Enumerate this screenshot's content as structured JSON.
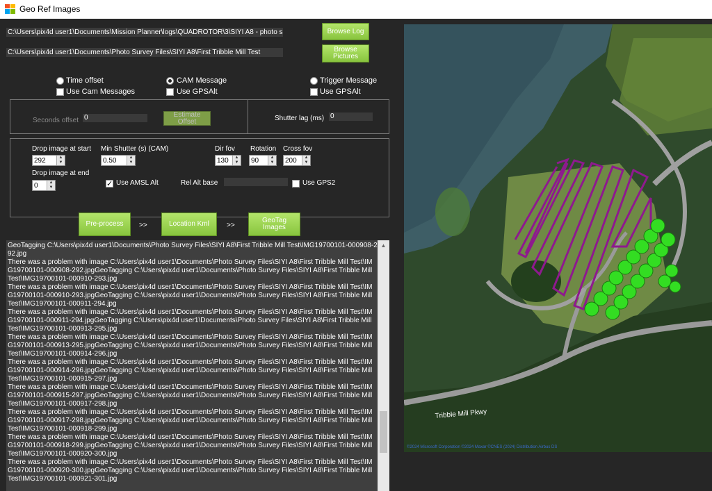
{
  "window": {
    "title": "Geo Ref Images"
  },
  "log_path": "C:\\Users\\pix4d user1\\Documents\\Mission Planner\\logs\\QUADROTOR\\3\\SIYI A8 - photo s",
  "pictures_path": "C:\\Users\\pix4d user1\\Documents\\Photo Survey Files\\SIYI A8\\First Tribble Mill Test",
  "buttons": {
    "browse_log": "Browse Log",
    "browse_pictures": "Browse Pictures",
    "estimate_offset": "Estimate Offset",
    "preprocess": "Pre-process",
    "location_kml": "Location Kml",
    "geotag_images": "GeoTag Images",
    "arrow": ">>"
  },
  "modes": {
    "time_offset": "Time offset",
    "cam_message": "CAM Message",
    "trigger_message": "Trigger Message",
    "use_cam_messages": "Use Cam Messages",
    "use_gpsalt_1": "Use GPSAlt",
    "use_gpsalt_2": "Use GPSAlt",
    "selected": "CAM Message"
  },
  "offset": {
    "seconds_label": "Seconds offset",
    "seconds_value": "0",
    "shutter_lag_label": "Shutter lag (ms)",
    "shutter_lag_value": "0"
  },
  "params": {
    "drop_start_label": "Drop image at start",
    "drop_start": "292",
    "drop_end_label": "Drop image at end",
    "drop_end": "0",
    "min_shutter_label": "Min Shutter (s) (CAM)",
    "min_shutter": "0.50",
    "use_amsl_label": "Use AMSL Alt",
    "dir_fov_label": "Dir fov",
    "dir_fov": "130",
    "rotation_label": "Rotation",
    "rotation": "90",
    "cross_fov_label": "Cross fov",
    "cross_fov": "200",
    "rel_alt_label": "Rel Alt base",
    "rel_alt": "",
    "use_gps2_label": "Use GPS2"
  },
  "log_text": "GeoTagging C:\\Users\\pix4d user1\\Documents\\Photo Survey Files\\SIYI A8\\First Tribble Mill Test\\IMG19700101-000908-292.jpg\nThere was a problem with image C:\\Users\\pix4d user1\\Documents\\Photo Survey Files\\SIYI A8\\First Tribble Mill Test\\IMG19700101-000908-292.jpgGeoTagging C:\\Users\\pix4d user1\\Documents\\Photo Survey Files\\SIYI A8\\First Tribble Mill Test\\IMG19700101-000910-293.jpg\nThere was a problem with image C:\\Users\\pix4d user1\\Documents\\Photo Survey Files\\SIYI A8\\First Tribble Mill Test\\IMG19700101-000910-293.jpgGeoTagging C:\\Users\\pix4d user1\\Documents\\Photo Survey Files\\SIYI A8\\First Tribble Mill Test\\IMG19700101-000911-294.jpg\nThere was a problem with image C:\\Users\\pix4d user1\\Documents\\Photo Survey Files\\SIYI A8\\First Tribble Mill Test\\IMG19700101-000911-294.jpgGeoTagging C:\\Users\\pix4d user1\\Documents\\Photo Survey Files\\SIYI A8\\First Tribble Mill Test\\IMG19700101-000913-295.jpg\nThere was a problem with image C:\\Users\\pix4d user1\\Documents\\Photo Survey Files\\SIYI A8\\First Tribble Mill Test\\IMG19700101-000913-295.jpgGeoTagging C:\\Users\\pix4d user1\\Documents\\Photo Survey Files\\SIYI A8\\First Tribble Mill Test\\IMG19700101-000914-296.jpg\nThere was a problem with image C:\\Users\\pix4d user1\\Documents\\Photo Survey Files\\SIYI A8\\First Tribble Mill Test\\IMG19700101-000914-296.jpgGeoTagging C:\\Users\\pix4d user1\\Documents\\Photo Survey Files\\SIYI A8\\First Tribble Mill Test\\IMG19700101-000915-297.jpg\nThere was a problem with image C:\\Users\\pix4d user1\\Documents\\Photo Survey Files\\SIYI A8\\First Tribble Mill Test\\IMG19700101-000915-297.jpgGeoTagging C:\\Users\\pix4d user1\\Documents\\Photo Survey Files\\SIYI A8\\First Tribble Mill Test\\IMG19700101-000917-298.jpg\nThere was a problem with image C:\\Users\\pix4d user1\\Documents\\Photo Survey Files\\SIYI A8\\First Tribble Mill Test\\IMG19700101-000917-298.jpgGeoTagging C:\\Users\\pix4d user1\\Documents\\Photo Survey Files\\SIYI A8\\First Tribble Mill Test\\IMG19700101-000918-299.jpg\nThere was a problem with image C:\\Users\\pix4d user1\\Documents\\Photo Survey Files\\SIYI A8\\First Tribble Mill Test\\IMG19700101-000918-299.jpgGeoTagging C:\\Users\\pix4d user1\\Documents\\Photo Survey Files\\SIYI A8\\First Tribble Mill Test\\IMG19700101-000920-300.jpg\nThere was a problem with image C:\\Users\\pix4d user1\\Documents\\Photo Survey Files\\SIYI A8\\First Tribble Mill Test\\IMG19700101-000920-300.jpgGeoTagging C:\\Users\\pix4d user1\\Documents\\Photo Survey Files\\SIYI A8\\First Tribble Mill Test\\IMG19700101-000921-301.jpg",
  "map": {
    "road_label": "Tribble Mill Pkwy",
    "attribution": "©2024 Microsoft Corporation ©2024 Maxar ©CNES (2024) Distribution Airbus DS"
  },
  "colors": {
    "button_green": "#9ad452",
    "track_purple": "#8e1a8e",
    "marker_green": "#33dd22",
    "background": "#262626"
  }
}
